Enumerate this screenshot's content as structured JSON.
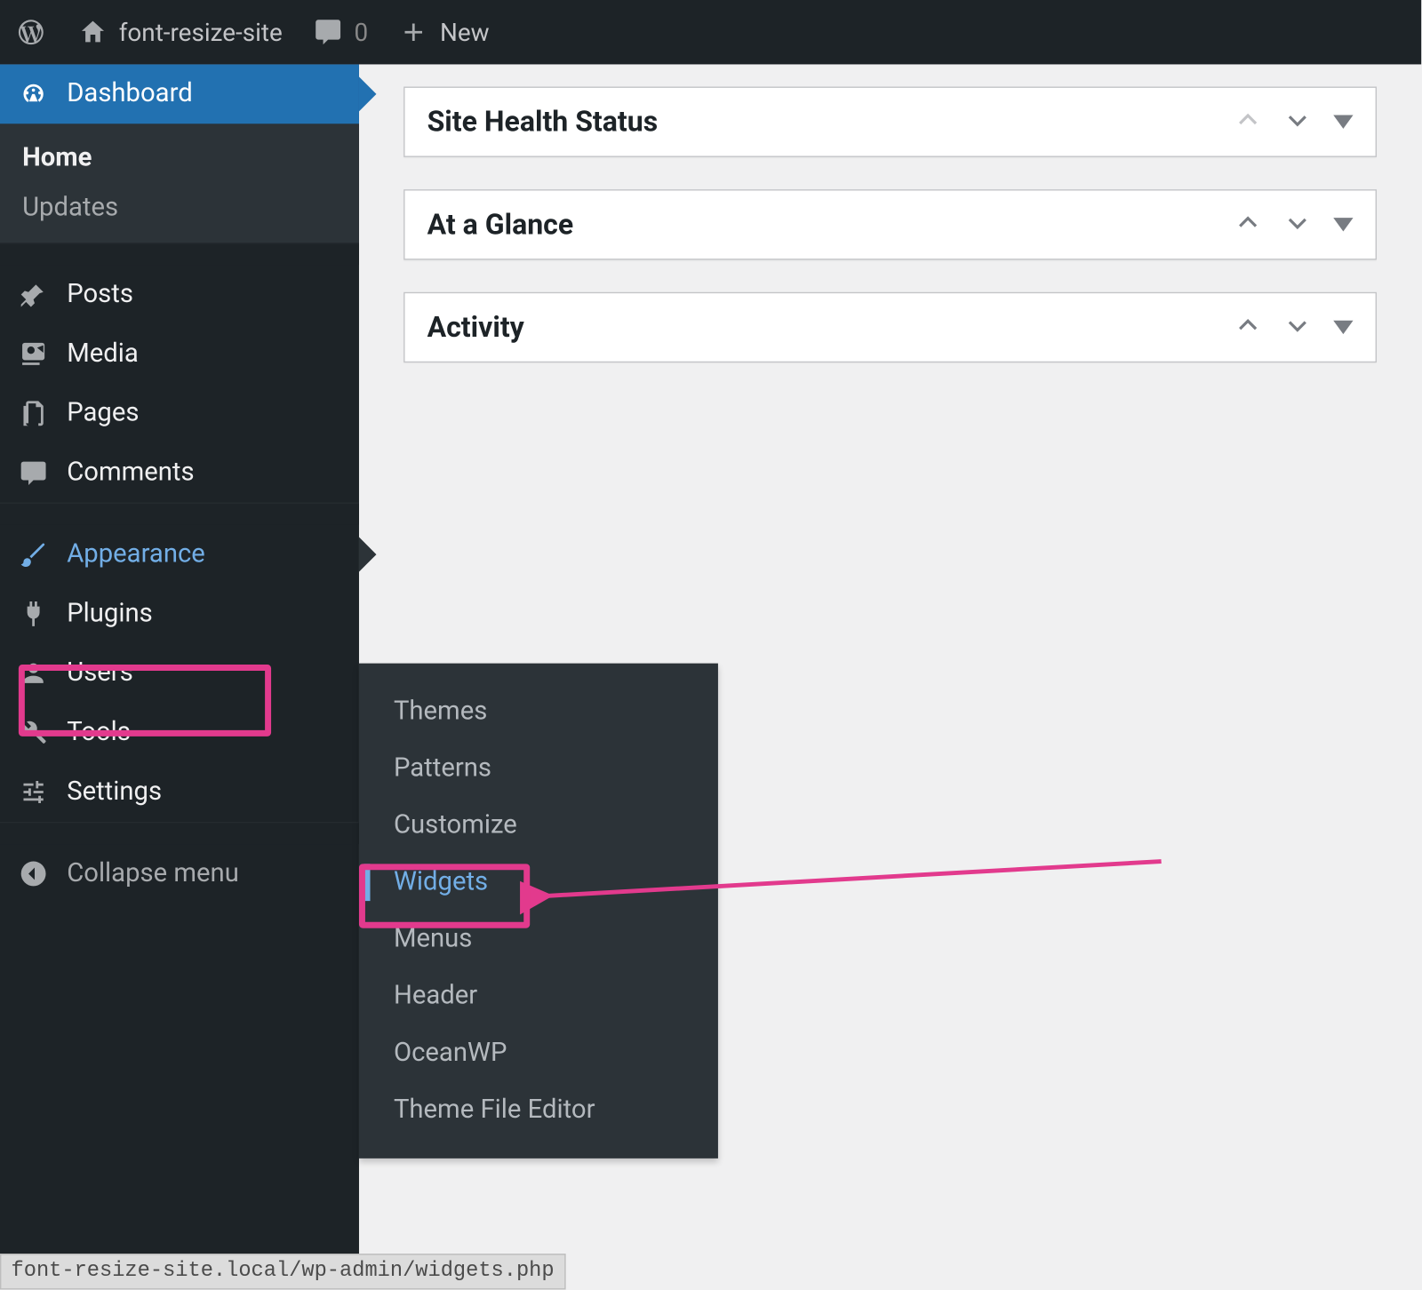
{
  "adminbar": {
    "site_name": "font-resize-site",
    "comments": "0",
    "new_label": "New"
  },
  "sidebar": {
    "dashboard": "Dashboard",
    "sub": {
      "home": "Home",
      "updates": "Updates"
    },
    "posts": "Posts",
    "media": "Media",
    "pages": "Pages",
    "comments": "Comments",
    "appearance": "Appearance",
    "plugins": "Plugins",
    "users": "Users",
    "tools": "Tools",
    "settings": "Settings",
    "collapse": "Collapse menu"
  },
  "flyout": {
    "items": [
      "Themes",
      "Patterns",
      "Customize",
      "Widgets",
      "Menus",
      "Header",
      "OceanWP",
      "Theme File Editor"
    ]
  },
  "content": {
    "boxes": [
      "Site Health Status",
      "At a Glance",
      "Activity"
    ]
  },
  "statusbar": "font-resize-site.local/wp-admin/widgets.php"
}
